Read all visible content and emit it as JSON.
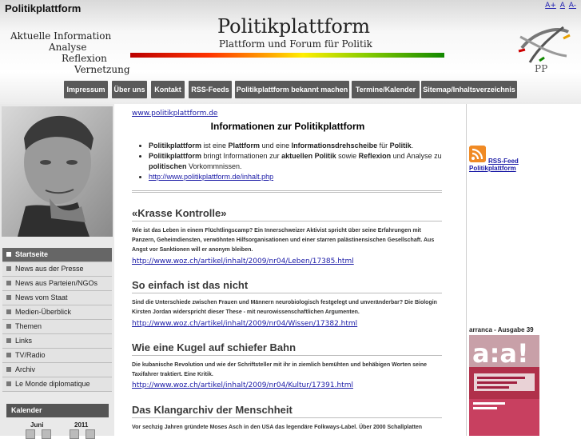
{
  "header": {
    "site_name": "Politikplattform",
    "font_controls": [
      "A+",
      "A",
      "A-"
    ],
    "tagline": [
      "Aktuelle Information",
      "Analyse",
      "Reflexion",
      "Vernetzung"
    ],
    "logo_title": "Politikplattform",
    "logo_subtitle": "Plattform und Forum für Politik",
    "emblem_text": "PP"
  },
  "nav": [
    {
      "label": "Impressum"
    },
    {
      "label": "Über uns"
    },
    {
      "label": "Kontakt"
    },
    {
      "label": "RSS-Feeds"
    },
    {
      "label": "Politikplattform bekannt machen"
    },
    {
      "label": "Termine/Kalender"
    },
    {
      "label": "Sitemap/Inhaltsverzeichnis"
    }
  ],
  "sidebar": {
    "items": [
      {
        "label": "Startseite",
        "active": true
      },
      {
        "label": "News aus der Presse"
      },
      {
        "label": "News aus Parteien/NGOs"
      },
      {
        "label": "News vom Staat"
      },
      {
        "label": "Medien-Überblick"
      },
      {
        "label": "Themen"
      },
      {
        "label": "Links"
      },
      {
        "label": "TV/Radio"
      },
      {
        "label": "Archiv"
      },
      {
        "label": "Le Monde diplomatique"
      }
    ],
    "calendar": {
      "title": "Kalender",
      "month": "Juni",
      "year": "2011"
    }
  },
  "main": {
    "site_url": "www.politikplattform.de",
    "info_title": "Informationen zur Politikplattform",
    "info_items": [
      {
        "b1": "Politikplattform",
        "t1": " ist eine ",
        "b2": "Plattform",
        "t2": " und eine ",
        "b3": "Informationsdrehscheibe",
        "t3": " für ",
        "b4": "Politik",
        "t4": "."
      },
      {
        "b1": "Politikplattform",
        "t1": " bringt Informationen zur ",
        "b2": "aktuellen Politik",
        "t2": " sowie ",
        "b3": "Reflexion",
        "t3": " und Analyse zu ",
        "b4": "politischen",
        "t4": " Vorkommnissen."
      }
    ],
    "info_link": "http://www.politikplattform.de/inhalt.php",
    "articles": [
      {
        "title": "«Krasse Kontrolle»",
        "text": "Wie ist das Leben in einem Flüchtlingscamp? Ein Innerschweizer Aktivist spricht über seine Erfahrungen mit Panzern, Geheimdiensten, verwöhnten Hilfsorganisationen und einer starren palästinensischen Gesellschaft. Aus Angst vor Sanktionen will er anonym bleiben.",
        "link": "http://www.woz.ch/artikel/inhalt/2009/nr04/Leben/17385.html"
      },
      {
        "title": "So einfach ist das nicht",
        "text": "Sind die Unterschiede zwischen Frauen und Männern neurobiologisch festgelegt und unveränderbar? Die Biologin Kirsten Jordan widerspricht dieser These - mit neurowissenschaftlichen Argumenten.",
        "link": "http://www.woz.ch/artikel/inhalt/2009/nr04/Wissen/17382.html"
      },
      {
        "title": "Wie eine Kugel auf schiefer Bahn",
        "text": "Die kubanische Revolution und wie der Schriftsteller mit ihr in ziemlich bemühten und behäbigen Worten seine Taxifahrer traktiert. Eine Kritik.",
        "link": "http://www.woz.ch/artikel/inhalt/2009/nr04/Kultur/17391.html"
      },
      {
        "title": "Das Klangarchiv der Menschheit",
        "text": "Vor sechzig Jahren gründete Moses Asch in den USA das legendäre Folkways-Label. Über 2000 Schallplatten",
        "link": ""
      }
    ]
  },
  "right": {
    "rss_label1": "RSS-Feed",
    "rss_label2": "Politikplattform",
    "magazine_label": "arranca - Ausgabe 39",
    "magazine_cover_text": "a:a!"
  },
  "colors": {
    "nav_bg": "#5a5a5a",
    "link": "#1a1aa6",
    "rss": "#f08a24",
    "magazine": "#b0304a"
  }
}
